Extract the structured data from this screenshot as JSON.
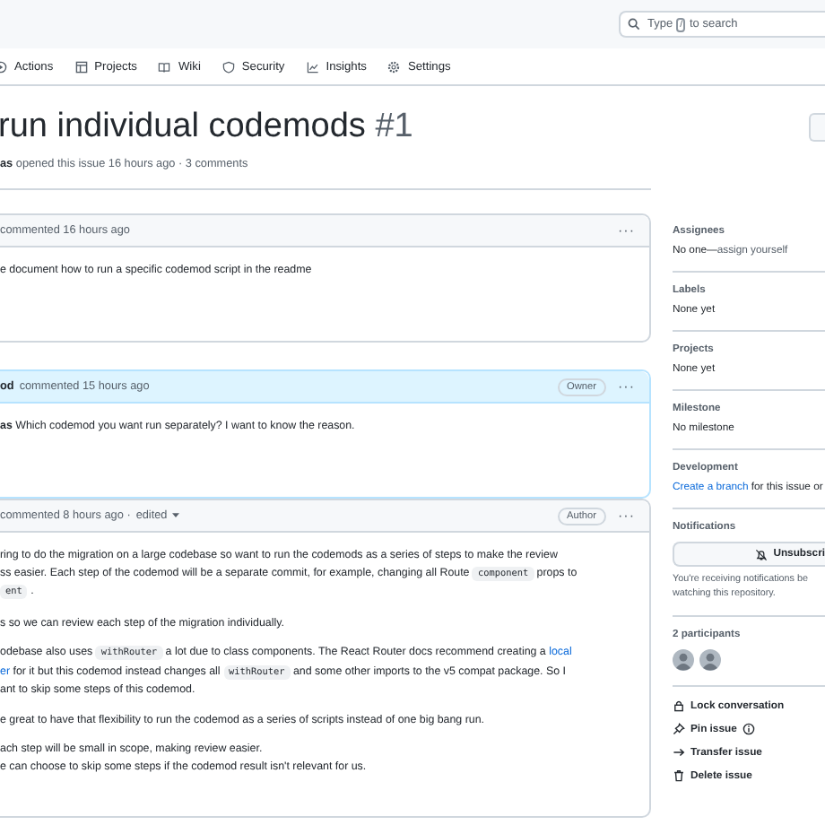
{
  "header": {
    "search": {
      "placeholder_before": "Type",
      "key": "/",
      "placeholder_after": "to search"
    }
  },
  "nav": [
    {
      "kind": "actions",
      "label": "Actions"
    },
    {
      "kind": "projects",
      "label": "Projects"
    },
    {
      "kind": "wiki",
      "label": "Wiki"
    },
    {
      "kind": "security",
      "label": "Security"
    },
    {
      "kind": "insights",
      "label": "Insights"
    },
    {
      "kind": "settings",
      "label": "Settings"
    }
  ],
  "issue": {
    "title": "run individual codemods",
    "number": "#1",
    "meta": "**as** opened this issue 16 hours ago · 3 comments"
  },
  "comments": [
    {
      "highlighted": false,
      "header": "commented 16 hours ago",
      "menu": "···",
      "paragraphs": [
        {
          "lines": [
            [
              {
                "kind": "text",
                "text": "e document how to run a specific codemod script in the readme"
              }
            ]
          ]
        }
      ]
    },
    {
      "highlighted": true,
      "author": "od",
      "header": "commented 15 hours ago",
      "badge": "Owner",
      "menu": "···",
      "paragraphs": [
        {
          "lines": [
            [
              {
                "kind": "rich",
                "text": "**as** Which codemod you want run separately? I want to know the reason."
              }
            ]
          ]
        }
      ]
    },
    {
      "highlighted": false,
      "header": "commented 8 hours ago ·",
      "edited": "edited",
      "badge": "Author",
      "menu": "···",
      "paragraphs": [
        {
          "lines": [
            [
              {
                "kind": "text",
                "text": "ring to do the migration on a large codebase so want to run the codemods as a series of steps to make the review"
              }
            ],
            [
              {
                "kind": "text",
                "text": "ss easier. Each step of the codemod will be a separate commit, for example, changing all Route "
              },
              {
                "kind": "code",
                "text": "component"
              },
              {
                "kind": "text",
                "text": " props to"
              }
            ],
            [
              {
                "kind": "code",
                "text": "ent"
              },
              {
                "kind": "text",
                "text": " ."
              }
            ]
          ]
        },
        {
          "lines": [
            [
              {
                "kind": "text",
                "text": "s so we can review each step of the migration individually."
              }
            ]
          ]
        },
        {
          "lines": [
            [
              {
                "kind": "text",
                "text": "odebase also uses "
              },
              {
                "kind": "code",
                "text": "withRouter"
              },
              {
                "kind": "text",
                "text": " a lot due to class components. The React Router docs recommend creating a "
              },
              {
                "kind": "link",
                "text": "local"
              }
            ],
            [
              {
                "kind": "link",
                "text": "er"
              },
              {
                "kind": "text",
                "text": " for it but this codemod instead changes all "
              },
              {
                "kind": "code",
                "text": "withRouter"
              },
              {
                "kind": "text",
                "text": " and some other imports to the v5 compat package. So I"
              }
            ],
            [
              {
                "kind": "text",
                "text": "ant to skip some steps of this codemod."
              }
            ]
          ]
        },
        {
          "lines": [
            [
              {
                "kind": "text",
                "text": "e great to have that flexibility to run the codemod as a series of scripts instead of one big bang run."
              }
            ]
          ]
        }
      ],
      "list_items": [
        [
          {
            "kind": "text",
            "text": "ach step will be small in scope, making review easier."
          }
        ],
        [
          {
            "kind": "text",
            "text": "e can choose to skip some steps if the codemod result isn't relevant for us."
          }
        ]
      ]
    }
  ],
  "sidebar": {
    "sections": [
      {
        "kind": "text",
        "heading": "Assignees",
        "value": "No one—",
        "link": "assign yourself"
      },
      {
        "kind": "text",
        "heading": "Labels",
        "value": "None yet"
      },
      {
        "kind": "text",
        "heading": "Projects",
        "value": "None yet"
      },
      {
        "kind": "text",
        "heading": "Milestone",
        "value": "No milestone"
      },
      {
        "kind": "development",
        "heading": "Development",
        "link": "Create a branch",
        "value": " for this issue or"
      },
      {
        "kind": "notifications",
        "heading": "Notifications",
        "button": "Unsubscri",
        "note": "You're receiving notifications be\nwatching this repository."
      },
      {
        "kind": "participants",
        "heading": "2 participants",
        "avatars": [
          {
            "kind": "person"
          },
          {
            "kind": "person"
          }
        ]
      }
    ],
    "actions": [
      {
        "kind": "lock",
        "label": "Lock conversation"
      },
      {
        "kind": "pin",
        "label": "Pin issue"
      },
      {
        "kind": "transfer",
        "label": "Transfer issue"
      },
      {
        "kind": "delete",
        "label": "Delete issue"
      }
    ]
  }
}
